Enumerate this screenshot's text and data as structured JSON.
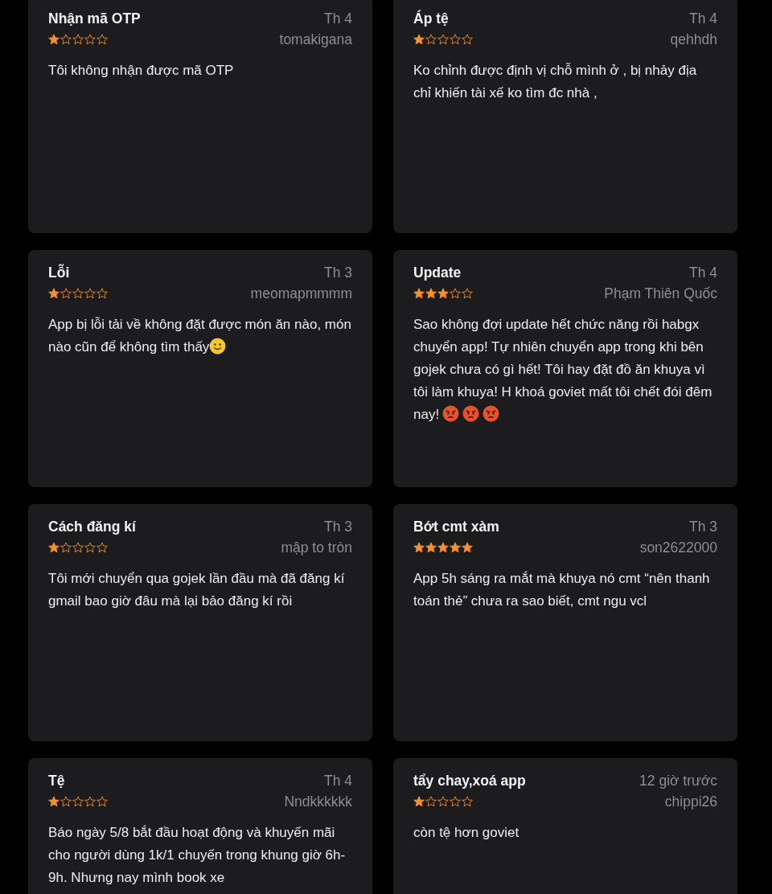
{
  "reviews": [
    {
      "title": "Nhận mã OTP",
      "date": "Th 4",
      "stars": 1,
      "author": "tomakigana",
      "body": "Tôi không nhận được mã OTP"
    },
    {
      "title": "Áp tệ",
      "date": "Th 4",
      "stars": 1,
      "author": "qehhdh",
      "body": "Ko chỉnh được định vị chỗ mình ở , bị nhảy địa chỉ khiến tài xế ko tìm đc nhà ,"
    },
    {
      "title": "Lỗi",
      "date": "Th 3",
      "stars": 1,
      "author": "meomapmmmm",
      "body": "App bị lỗi tải về không đặt được món ăn nào, món nào cũn để không tìm thấy",
      "emojis": [
        {
          "kind": "smile"
        }
      ]
    },
    {
      "title": "Update",
      "date": "Th 4",
      "stars": 3,
      "author": "Phạm Thiên Quốc",
      "body": "Sao không đợi update hết chức năng rồi habgx chuyển app! Tự nhiên chuyển app trong khi bên gojek chưa có gì hết! Tôi hay đặt đồ ăn khuya vì tôi làm khuya! H khoá goviet mất tôi chết đói đêm nay!",
      "emojis": [
        {
          "kind": "angry"
        },
        {
          "kind": "angry"
        },
        {
          "kind": "angry"
        }
      ]
    },
    {
      "title": "Cách đăng kí",
      "date": "Th 3",
      "stars": 1,
      "author": "mập to tròn",
      "body": "Tôi mới chuyển qua gojek lần đầu mà đã đăng kí gmail bao giờ đâu mà lại bảo đăng kí rồi"
    },
    {
      "title": "Bớt cmt xàm",
      "date": "Th 3",
      "stars": 5,
      "author": "son2622000",
      "body": "App 5h sáng ra mắt mà khuya nó cmt “nên thanh toán thẻ” chưa ra sao biết, cmt ngu vcl"
    },
    {
      "title": "Tệ",
      "date": "Th 4",
      "stars": 1,
      "author": "Nndkkkkkk",
      "body": "Báo ngày 5/8 bắt đầu hoạt động và khuyến mãi cho người dùng 1k/1 chuyến trong khung giờ 6h-9h. Nhưng nay mình book xe"
    },
    {
      "title": "tẩy chay,xoá app",
      "date": "12 giờ trước",
      "stars": 1,
      "author": "chippi26",
      "body": "còn tệ hơn goviet"
    }
  ]
}
